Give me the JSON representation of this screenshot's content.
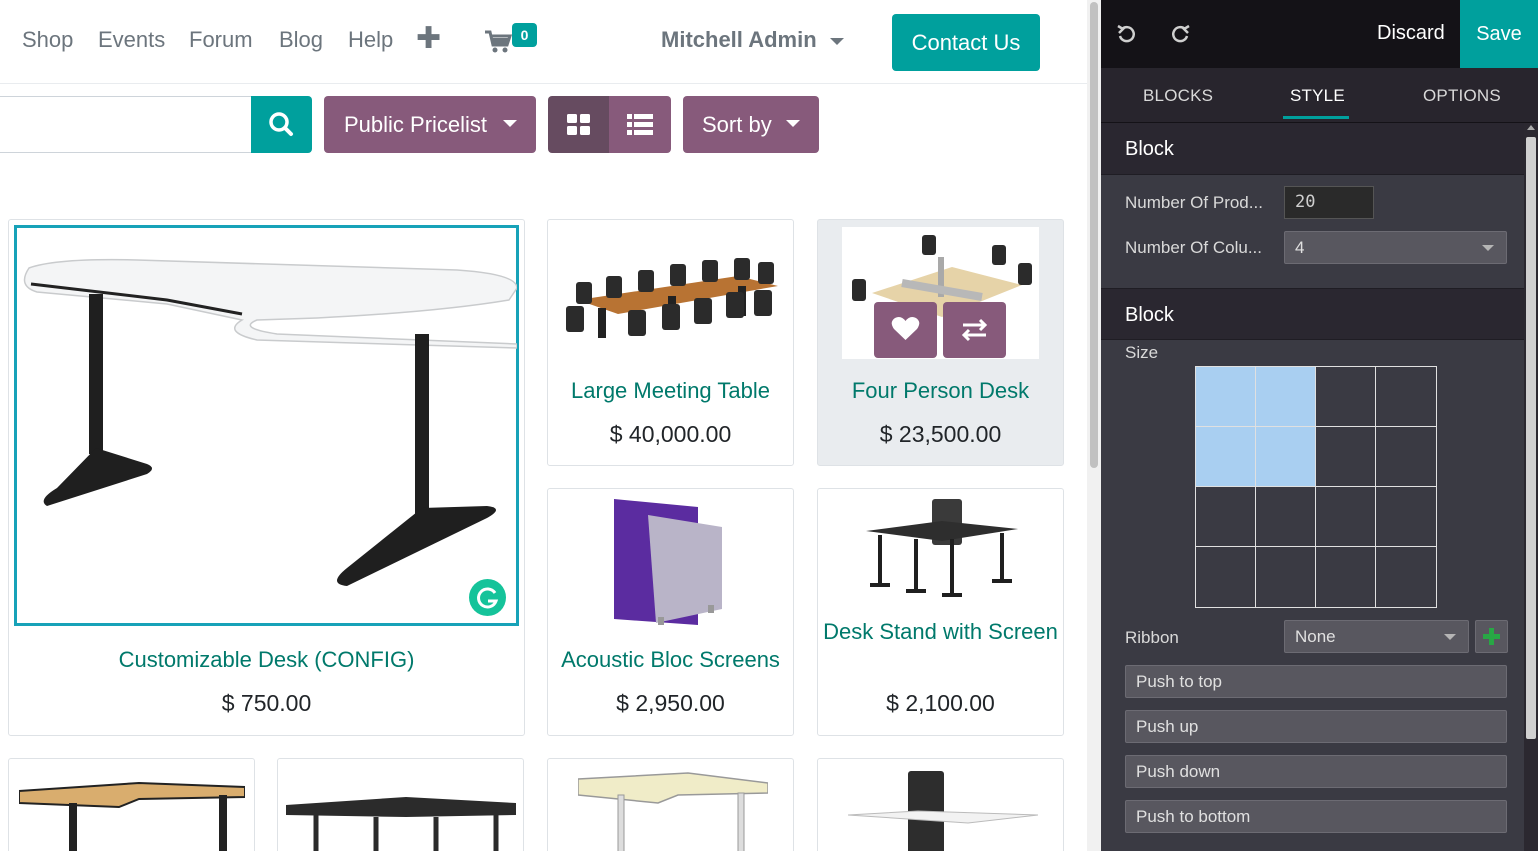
{
  "nav": {
    "links": [
      "Shop",
      "Events",
      "Forum",
      "Blog",
      "Help"
    ],
    "cart_count": "0",
    "user": "Mitchell Admin",
    "contact": "Contact Us"
  },
  "toolbar": {
    "search_placeholder": "",
    "pricelist": "Public Pricelist",
    "sort": "Sort by",
    "active_view": "grid"
  },
  "products": [
    {
      "name": "Customizable Desk (CONFIG)",
      "price": "$ 750.00"
    },
    {
      "name": "Large Meeting Table",
      "price": "$ 40,000.00"
    },
    {
      "name": "Four Person Desk",
      "price": "$ 23,500.00"
    },
    {
      "name": "Acoustic Bloc Screens",
      "price": "$ 2,950.00"
    },
    {
      "name": "Desk Stand with Screen",
      "price": "$ 2,100.00"
    }
  ],
  "editor": {
    "discard": "Discard",
    "save": "Save",
    "tabs": [
      "BLOCKS",
      "STYLE",
      "OPTIONS"
    ],
    "active_tab": "STYLE",
    "block1": {
      "title": "Block",
      "num_products_label": "Number Of Prod...",
      "num_products_value": "20",
      "num_columns_label": "Number Of Colu...",
      "num_columns_value": "4"
    },
    "block2": {
      "title": "Block",
      "size_label": "Size",
      "size_selected": {
        "cols": 2,
        "rows": 2
      },
      "ribbon_label": "Ribbon",
      "ribbon_value": "None",
      "push_top": "Push to top",
      "push_up": "Push up",
      "push_down": "Push down",
      "push_bottom": "Push to bottom"
    }
  },
  "colors": {
    "primary": "#00a09d",
    "secondary": "#875a7b",
    "product_name": "#00796b",
    "editor_bg": "#3a3a43",
    "size_selected": "#a9cff1"
  }
}
